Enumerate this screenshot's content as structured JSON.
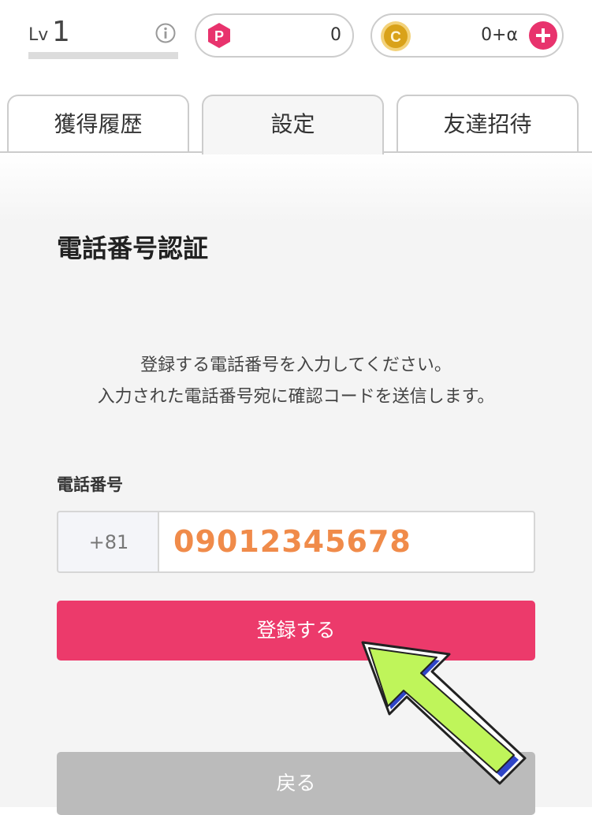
{
  "header": {
    "level_prefix": "Lv",
    "level_value": "1",
    "points_value": "0",
    "coins_value": "0+α",
    "points_icon_letter": "P",
    "coins_icon_letter": "C",
    "colors": {
      "accent": "#e8336d",
      "coin": "#e6b422"
    }
  },
  "tabs": [
    {
      "label": "獲得履歴"
    },
    {
      "label": "設定",
      "active": true
    },
    {
      "label": "友達招待"
    }
  ],
  "main": {
    "title": "電話番号認証",
    "description_line1": "登録する電話番号を入力してください。",
    "description_line2": "入力された電話番号宛に確認コードを送信します。",
    "phone_label": "電話番号",
    "country_code": "+81",
    "phone_value": "09012345678",
    "submit_label": "登録する",
    "back_label": "戻る"
  },
  "icons": [
    "info-icon",
    "points-icon",
    "coin-icon",
    "plus-icon",
    "pointer-arrow-icon"
  ]
}
